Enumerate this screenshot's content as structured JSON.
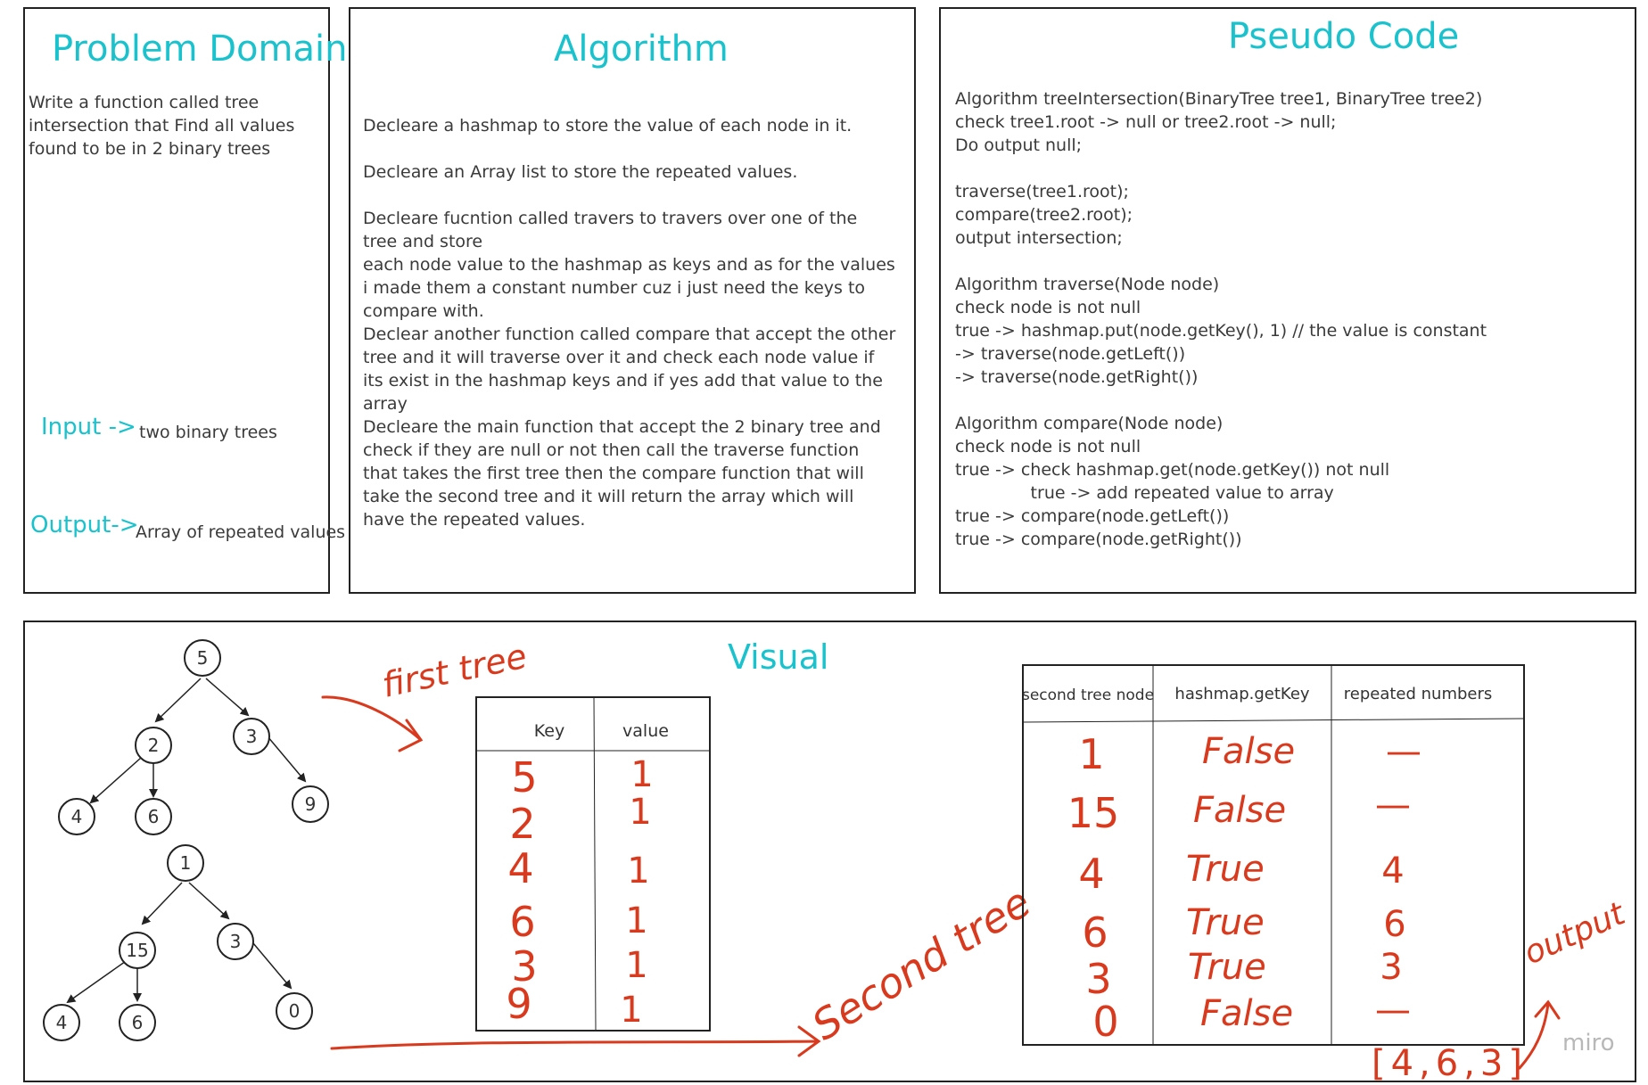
{
  "problem": {
    "title": "Problem Domain",
    "description": "Write a function called tree intersection that Find all values found to be in 2 binary trees",
    "input_label": "Input ->",
    "input_value": "two binary trees",
    "output_label": "Output->",
    "output_value": "Array of repeated values"
  },
  "algorithm": {
    "title": "Algorithm",
    "steps": [
      "Decleare a hashmap to store the value of each node in it.",
      "Decleare an Array list to store the repeated values.",
      "Decleare fucntion called travers to travers over one of the tree and store",
      "each node value to the hashmap as keys and as for the values i made them a constant number cuz i just need the keys to compare with.",
      "Declear another function called compare that accept the other tree and it will traverse over it and check each node value if its exist in the hashmap keys and if yes add that value to the array",
      "Decleare the main function that accept the 2 binary tree and check if they are null or not then call the traverse function that takes the first tree then the compare function that will take the second tree and it will return the array which will have the repeated values."
    ]
  },
  "pseudo": {
    "title": "Pseudo Code",
    "lines": [
      "Algorithm treeIntersection(BinaryTree tree1, BinaryTree tree2)",
      "check  tree1.root -> null or tree2.root -> null;",
      "Do output null;",
      "",
      "traverse(tree1.root);",
      "compare(tree2.root);",
      "output intersection;",
      "",
      "Algorithm traverse(Node node)",
      "check node is not null",
      "true -> hashmap.put(node.getKey(), 1) // the value is constant",
      "-> traverse(node.getLeft())",
      "-> traverse(node.getRight())",
      "",
      "Algorithm compare(Node node)",
      "check node is not null",
      "true -> check hashmap.get(node.getKey()) not null",
      "              true -> add repeated value to array",
      "true -> compare(node.getLeft())",
      "true -> compare(node.getRight())"
    ]
  },
  "visual": {
    "title": "Visual",
    "first_tree_label": "first tree",
    "second_tree_label": "Second tree",
    "tree1": {
      "root": "5",
      "n2": "2",
      "n3": "3",
      "n4": "4",
      "n6": "6",
      "n9": "9"
    },
    "tree2": {
      "root": "1",
      "n15": "15",
      "n3": "3",
      "n4": "4",
      "n6": "6",
      "n0": "0"
    },
    "hashmap_table": {
      "headers": [
        "Key",
        "value"
      ],
      "keys": [
        "5",
        "2",
        "4",
        "6",
        "3",
        "9"
      ],
      "values": [
        "1",
        "1",
        "1",
        "1",
        "1",
        "1"
      ]
    },
    "compare_table": {
      "headers": [
        "second tree node",
        "hashmap.getKey",
        "repeated numbers"
      ],
      "nodes": [
        "1",
        "15",
        "4",
        "6",
        "3",
        "0"
      ],
      "get_key": [
        "False",
        "False",
        "True",
        "True",
        "True",
        "False"
      ],
      "repeated": [
        "—",
        "—",
        "4",
        "6",
        "3",
        "—"
      ]
    },
    "output_label": "output",
    "result": "[4,6,3]",
    "watermark": "miro"
  },
  "colors": {
    "accent": "#19c2cc",
    "ink": "#d9391c",
    "border": "#222222"
  }
}
